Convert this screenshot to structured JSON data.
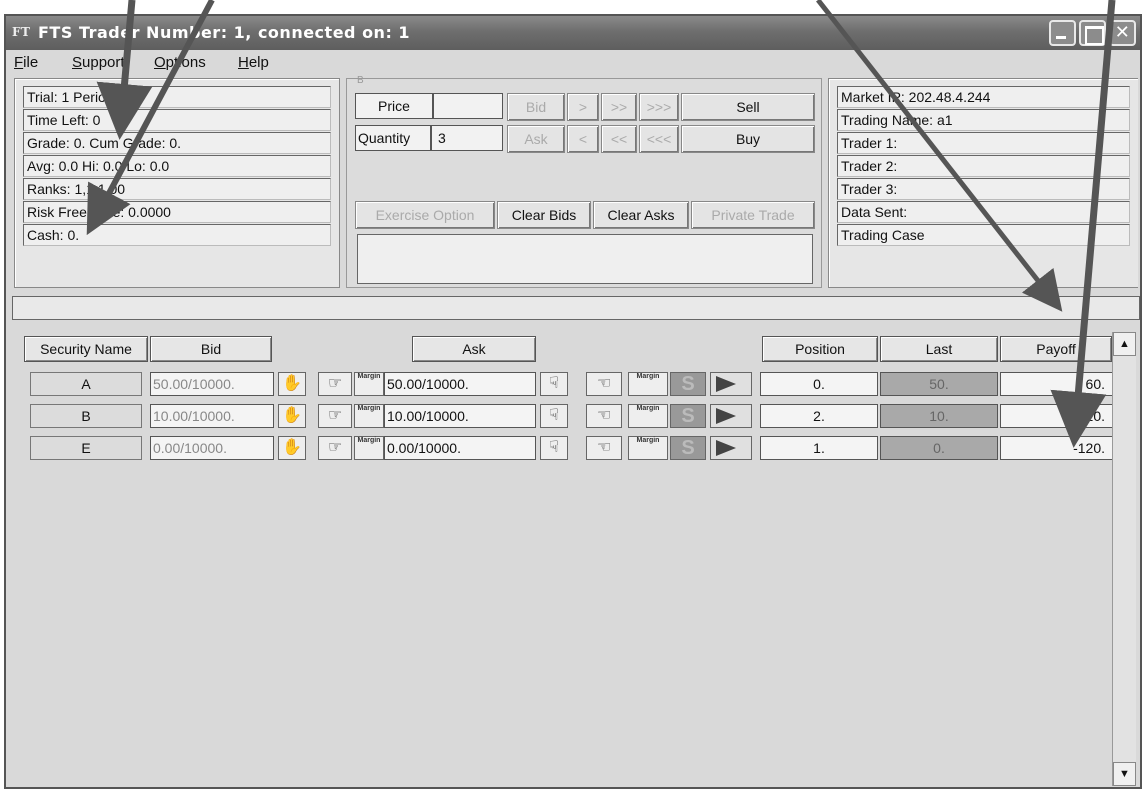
{
  "window": {
    "title": "FTS Trader Number: 1, connected on: 1",
    "app_icon_text": "FT"
  },
  "menu": [
    "File",
    "Support",
    "Options",
    "Help"
  ],
  "menu_mnemonics": [
    "F",
    "S",
    "O",
    "H"
  ],
  "left_panel": {
    "lines": [
      "Trial: 1 Period: 1",
      "Time Left: 0",
      "Grade: 0. Cum Grade: 0.",
      "Avg: 0.0 Hi: 0.0 Lo: 0.0",
      "Ranks: 1,1,1.00",
      "Risk Free Rate: 0.0000",
      "Cash: 0."
    ]
  },
  "trade_panel": {
    "group_label": "B",
    "price_label": "Price",
    "price_value": "",
    "quantity_label": "Quantity",
    "quantity_value": "3",
    "bid_label": "Bid",
    "ask_label": "Ask",
    "up_labels": [
      ">",
      ">>",
      ">>>"
    ],
    "down_labels": [
      "<",
      "<<",
      "<<<"
    ],
    "sell_label": "Sell",
    "buy_label": "Buy",
    "exercise_option_label": "Exercise Option",
    "clear_bids_label": "Clear Bids",
    "clear_asks_label": "Clear Asks",
    "private_trade_label": "Private Trade"
  },
  "right_panel": {
    "lines": [
      "Market IP: 202.48.4.244",
      "Trading Name: a1",
      "Trader 1:",
      "Trader 2:",
      "Trader 3:",
      "Data Sent:",
      "Trading Case"
    ]
  },
  "table": {
    "headers": {
      "security_name": "Security Name",
      "bid": "Bid",
      "ask": "Ask",
      "position": "Position",
      "last": "Last",
      "payoff": "Payoff"
    },
    "icon_labels": {
      "margin": "Margin",
      "sell_short": "S"
    },
    "rows": [
      {
        "name": "A",
        "bid": "50.00/10000.",
        "ask": "50.00/10000.",
        "position": "0.",
        "last": "50.",
        "payoff": "60."
      },
      {
        "name": "B",
        "bid": "10.00/10000.",
        "ask": "10.00/10000.",
        "position": "2.",
        "last": "10.",
        "payoff": "20."
      },
      {
        "name": "E",
        "bid": "0.00/10000.",
        "ask": "0.00/10000.",
        "position": "1.",
        "last": "0.",
        "payoff": "-120."
      }
    ]
  },
  "colors": {
    "title_bar": "#6e6e6e",
    "window_bg": "#d9d9d9",
    "last_cell_bg": "#a9a9a9",
    "annotation_arrow": "#555555"
  }
}
